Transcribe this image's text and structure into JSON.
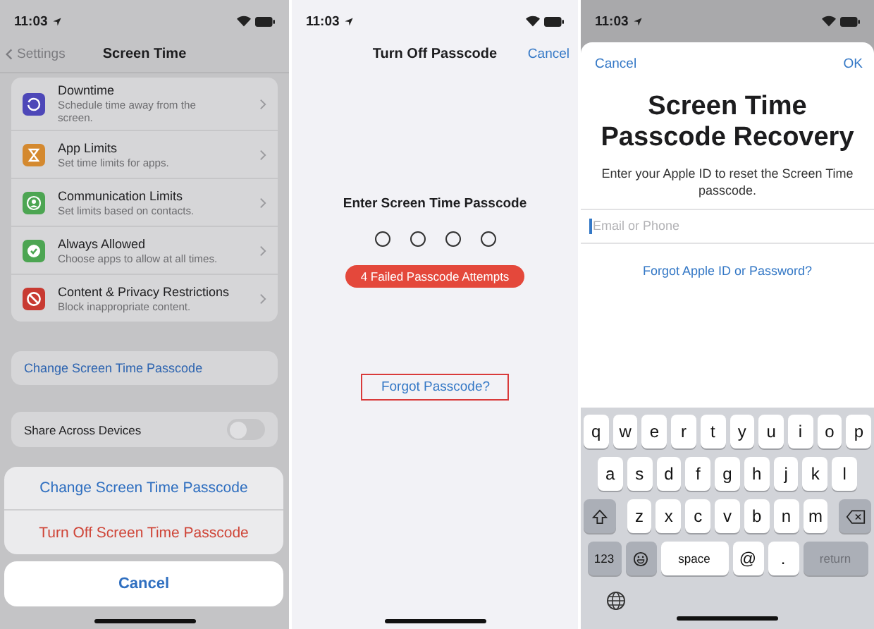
{
  "screen_time_settings": {
    "status_time": "11:03",
    "back_label": "Settings",
    "title": "Screen Time",
    "items": [
      {
        "kind": "moon",
        "color": "#4d47b8",
        "title": "Downtime",
        "subtitle": "Schedule time away from the screen."
      },
      {
        "kind": "hourglass",
        "color": "#d4892f",
        "title": "App Limits",
        "subtitle": "Set time limits for apps."
      },
      {
        "kind": "person",
        "color": "#4ca552",
        "title": "Communication Limits",
        "subtitle": "Set limits based on contacts."
      },
      {
        "kind": "check",
        "color": "#4ca552",
        "title": "Always Allowed",
        "subtitle": "Choose apps to allow at all times."
      },
      {
        "kind": "prohibited",
        "color": "#c83a32",
        "title": "Content & Privacy Restrictions",
        "subtitle": "Block inappropriate content."
      }
    ],
    "change_passcode": "Change Screen Time Passcode",
    "share": {
      "label": "Share Across Devices",
      "on": false
    },
    "action_sheet": {
      "actions": [
        {
          "label": "Change Screen Time Passcode",
          "destructive": false
        },
        {
          "label": "Turn Off Screen Time Passcode",
          "destructive": true
        }
      ],
      "cancel": "Cancel"
    }
  },
  "turn_off_passcode": {
    "status_time": "11:03",
    "title": "Turn Off Passcode",
    "cancel": "Cancel",
    "prompt": "Enter Screen Time Passcode",
    "digits": [
      {
        "filled": false
      },
      {
        "filled": false
      },
      {
        "filled": false
      },
      {
        "filled": false
      }
    ],
    "failed_badge": "4 Failed Passcode Attempts",
    "forgot_link": {
      "label": "Forgot Passcode?",
      "highlighted": true
    }
  },
  "passcode_recovery": {
    "status_time": "11:03",
    "cancel": "Cancel",
    "ok": "OK",
    "title": "Screen Time Passcode Recovery",
    "subtitle": "Enter your Apple ID to reset the Screen Time passcode.",
    "field": {
      "placeholder": "Email or Phone",
      "focused": true
    },
    "forgot_link": "Forgot Apple ID or Password?",
    "keyboard": {
      "rows": [
        [
          "q",
          "w",
          "e",
          "r",
          "t",
          "y",
          "u",
          "i",
          "o",
          "p"
        ],
        [
          "a",
          "s",
          "d",
          "f",
          "g",
          "h",
          "j",
          "k",
          "l"
        ],
        [
          "z",
          "x",
          "c",
          "v",
          "b",
          "n",
          "m"
        ]
      ],
      "bottom": [
        {
          "kind": "mode",
          "label": "123"
        },
        {
          "kind": "emoji"
        },
        {
          "kind": "space",
          "label": "space"
        },
        {
          "kind": "char",
          "label": "@"
        },
        {
          "kind": "char",
          "label": "."
        },
        {
          "kind": "return",
          "label": "return",
          "disabled": true
        }
      ]
    }
  }
}
